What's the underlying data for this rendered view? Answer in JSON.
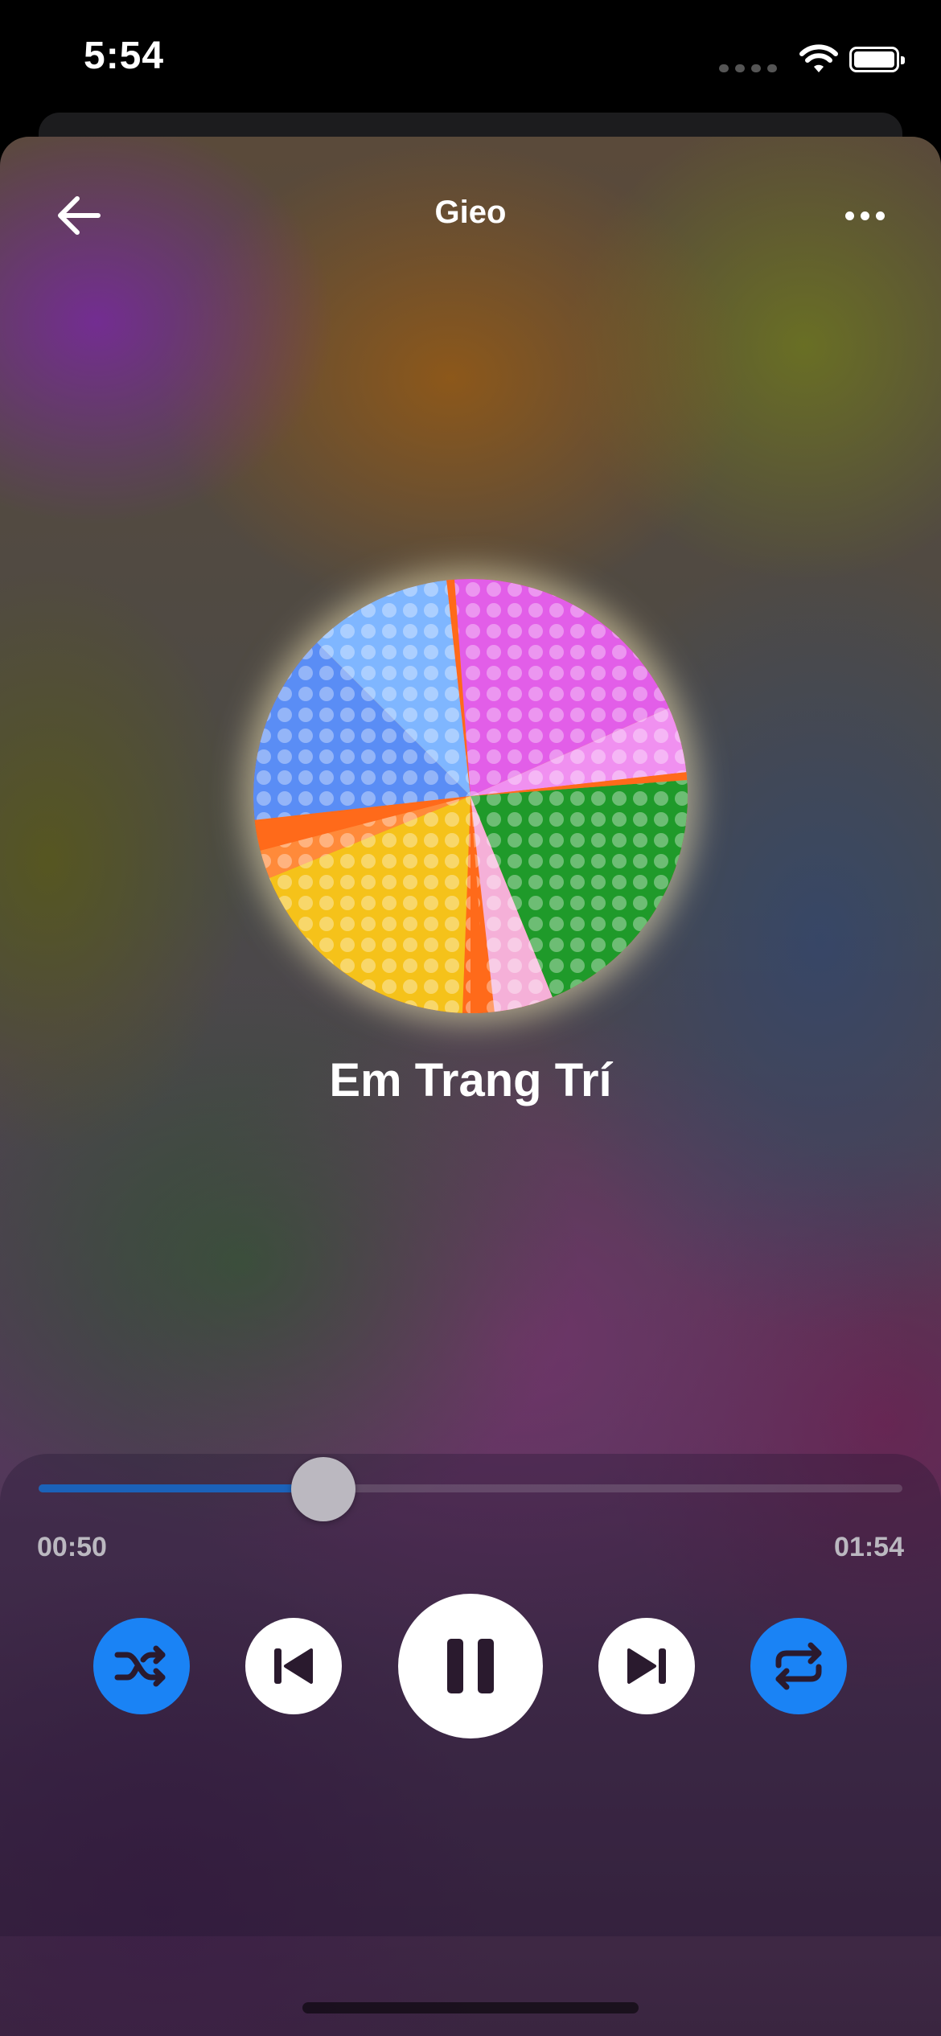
{
  "status_bar": {
    "time": "5:54",
    "icons": [
      "signal-icon",
      "wifi-icon",
      "battery-icon"
    ]
  },
  "header": {
    "title": "Gieo",
    "back_icon": "arrow-left-icon",
    "more_icon": "more-horizontal-icon"
  },
  "track": {
    "title": "Em Trang Trí",
    "artwork_icon": "album-artwork"
  },
  "playback": {
    "elapsed": "00:50",
    "total": "01:54",
    "progress_fraction": 0.33
  },
  "controls": {
    "shuffle_icon": "shuffle-icon",
    "previous_icon": "skip-back-icon",
    "play_pause_icon": "pause-icon",
    "next_icon": "skip-forward-icon",
    "repeat_icon": "repeat-icon"
  },
  "colors": {
    "accent": "#1a83f5",
    "icon_dark": "#2a1a2e"
  }
}
